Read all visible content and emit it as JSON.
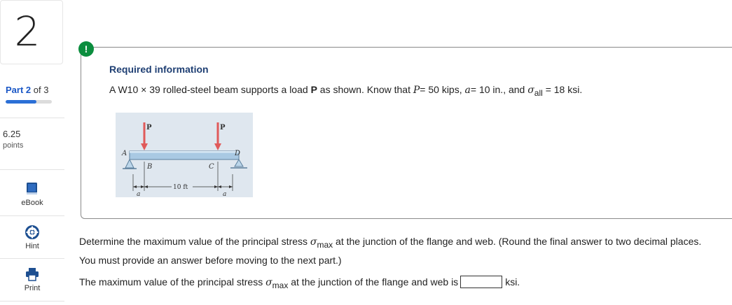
{
  "question_number": "2",
  "part": {
    "prefix": "Part",
    "current": "2",
    "suffix": "of 3",
    "progress": 0.667
  },
  "points": {
    "value": "6.25",
    "label": "points"
  },
  "tools": [
    {
      "name": "ebook",
      "label": "eBook"
    },
    {
      "name": "hint",
      "label": "Hint"
    },
    {
      "name": "print",
      "label": "Print"
    }
  ],
  "alert_glyph": "!",
  "required": {
    "title": "Required information",
    "intro": "A W10 × 39 rolled-steel beam supports a load",
    "load_symbol": "P",
    "as_shown": "as shown. Know that",
    "p_symbol": "P",
    "p_value": "= 50 kips,",
    "a_symbol": "a",
    "a_value": "= 10 in., and",
    "sigma": "σ",
    "sigma_sub": "all",
    "sigma_value": "= 18 ksi."
  },
  "figure": {
    "load_label_left": "P",
    "load_label_right": "P",
    "point_a": "A",
    "point_b": "B",
    "point_c": "C",
    "point_d": "D",
    "span_label": "10 ft",
    "dim_a_left": "a",
    "dim_a_right": "a"
  },
  "question": {
    "part1": "Determine the maximum value of the principal stress",
    "sigma": "σ",
    "sub": "max",
    "part2": "at the junction of the flange and web. (Round the final answer to two decimal places. You must provide an answer before moving to the next part.)"
  },
  "answer": {
    "prefix": "The maximum value of the principal stress",
    "sigma": "σ",
    "sub": "max",
    "middle": "at the junction of the flange and web is",
    "value": "",
    "unit": "ksi."
  },
  "colors": {
    "accent_blue": "#2b6fd6",
    "alert_green": "#0b8d3e",
    "title_blue": "#1f3f73",
    "load_arrow": "#e05a5a"
  }
}
